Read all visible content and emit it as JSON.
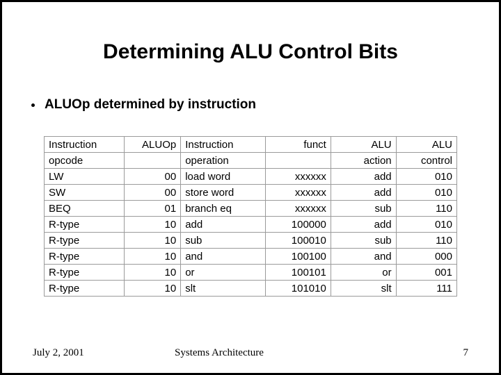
{
  "title": "Determining ALU Control Bits",
  "bullet": "ALUOp determined by instruction",
  "chart_data": {
    "type": "table",
    "headers": {
      "instr_a": "Instruction",
      "instr_b": "opcode",
      "aluop": "ALUOp",
      "op_a": "Instruction",
      "op_b": "operation",
      "funct": "funct",
      "action_a": "ALU",
      "action_b": "action",
      "ctrl_a": "ALU",
      "ctrl_b": "control"
    },
    "rows": [
      {
        "instr": "LW",
        "aluop": "00",
        "op": "load word",
        "funct": "xxxxxx",
        "action": "add",
        "ctrl": "010"
      },
      {
        "instr": "SW",
        "aluop": "00",
        "op": "store word",
        "funct": "xxxxxx",
        "action": "add",
        "ctrl": "010"
      },
      {
        "instr": "BEQ",
        "aluop": "01",
        "op": "branch eq",
        "funct": "xxxxxx",
        "action": "sub",
        "ctrl": "110"
      },
      {
        "instr": "R-type",
        "aluop": "10",
        "op": "add",
        "funct": "100000",
        "action": "add",
        "ctrl": "010"
      },
      {
        "instr": "R-type",
        "aluop": "10",
        "op": "sub",
        "funct": "100010",
        "action": "sub",
        "ctrl": "110"
      },
      {
        "instr": "R-type",
        "aluop": "10",
        "op": "and",
        "funct": "100100",
        "action": "and",
        "ctrl": "000"
      },
      {
        "instr": "R-type",
        "aluop": "10",
        "op": "or",
        "funct": "100101",
        "action": "or",
        "ctrl": "001"
      },
      {
        "instr": "R-type",
        "aluop": "10",
        "op": "slt",
        "funct": "101010",
        "action": "slt",
        "ctrl": "111"
      }
    ]
  },
  "footer": {
    "date": "July 2, 2001",
    "course": "Systems Architecture",
    "page": "7"
  }
}
